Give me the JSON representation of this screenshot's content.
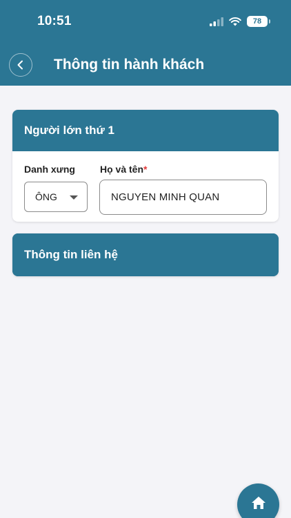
{
  "status_bar": {
    "time": "10:51",
    "battery": "78"
  },
  "header": {
    "title": "Thông tin hành khách"
  },
  "adult_card": {
    "heading": "Người lớn thứ 1",
    "title_label": "Danh xưng",
    "title_value": "ÔNG",
    "name_label": "Họ và tên",
    "required_mark": "*",
    "name_value": "NGUYEN MINH QUAN"
  },
  "contact_card": {
    "heading": "Thông tin liên hệ"
  },
  "icons": {
    "back": "chevron-left-icon",
    "home": "home-icon",
    "signal": "cellular-signal-icon",
    "wifi": "wifi-icon",
    "battery": "battery-icon"
  },
  "colors": {
    "primary": "#2b7694",
    "background": "#f4f4f8",
    "required": "#e03a3a"
  }
}
